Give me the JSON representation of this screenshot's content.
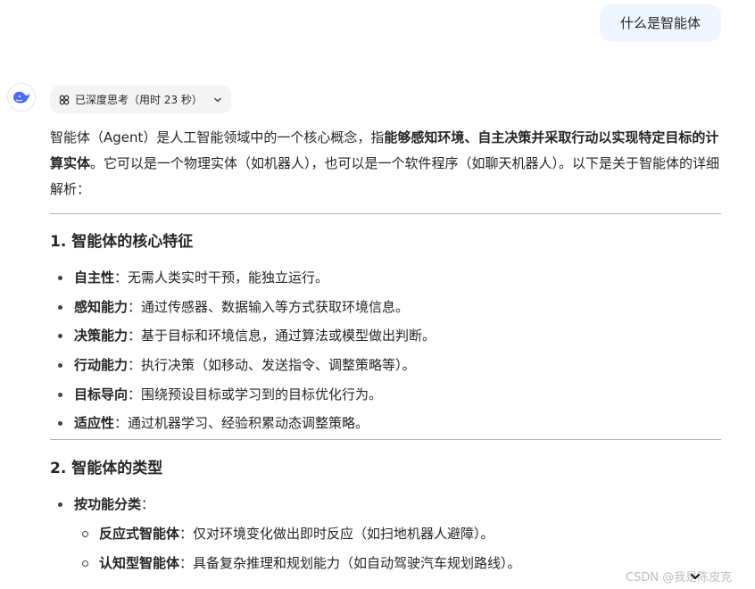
{
  "user_message": "什么是智能体",
  "thinking": {
    "label": "已深度思考（用时 23 秒）"
  },
  "intro": {
    "part1": "智能体（Agent）是人工智能领域中的一个核心概念，指",
    "bold": "能够感知环境、自主决策并采取行动以实现特定目标的计算实体",
    "part2": "。它可以是一个物理实体（如机器人），也可以是一个软件程序（如聊天机器人）。以下是关于智能体的详细解析："
  },
  "section1": {
    "title": "1. 智能体的核心特征",
    "items": [
      {
        "term": "自主性",
        "desc": "：无需人类实时干预，能独立运行。"
      },
      {
        "term": "感知能力",
        "desc": "：通过传感器、数据输入等方式获取环境信息。"
      },
      {
        "term": "决策能力",
        "desc": "：基于目标和环境信息，通过算法或模型做出判断。"
      },
      {
        "term": "行动能力",
        "desc": "：执行决策（如移动、发送指令、调整策略等）。"
      },
      {
        "term": "目标导向",
        "desc": "：围绕预设目标或学习到的目标优化行为。"
      },
      {
        "term": "适应性",
        "desc": "：通过机器学习、经验积累动态调整策略。"
      }
    ]
  },
  "section2": {
    "title": "2. 智能体的类型",
    "items": [
      {
        "term": "按功能分类",
        "desc": "："
      }
    ],
    "subitems": [
      {
        "term": "反应式智能体",
        "desc": "：仅对环境变化做出即时反应（如扫地机器人避障）。"
      },
      {
        "term": "认知型智能体",
        "desc": "：具备复杂推理和规划能力（如自动驾驶汽车规划路线）。"
      }
    ]
  },
  "watermark": "CSDN @我是陈皮克",
  "icons": {
    "avatar": "deepseek-whale-icon",
    "thinking": "deep-think-icon",
    "chevron": "chevron-down-icon",
    "scroll": "arrow-down-icon"
  },
  "colors": {
    "user_bubble": "#eff6ff",
    "avatar_brand": "#4d6bfe",
    "pill": "#f4f4f5"
  }
}
